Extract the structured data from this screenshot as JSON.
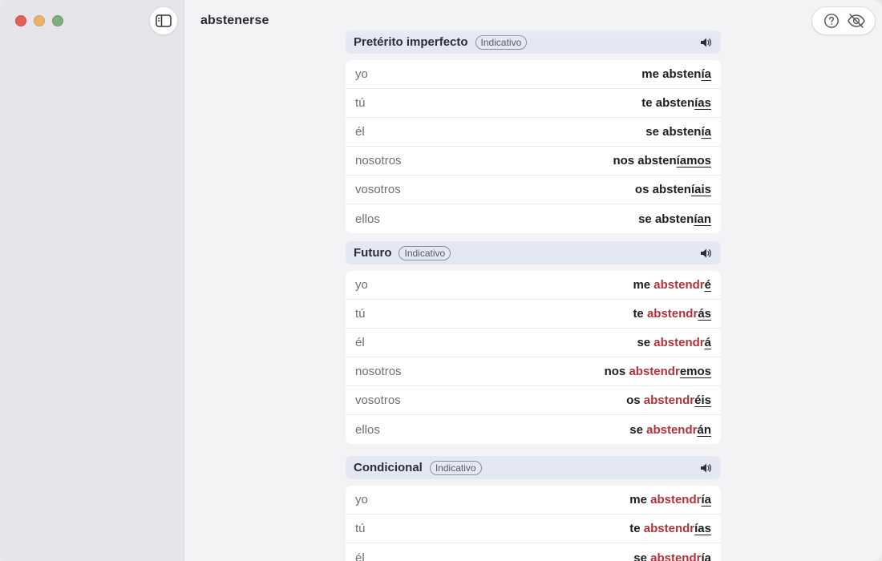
{
  "window": {
    "title": "abstenerse"
  },
  "colors": {
    "irregular_stem": "#b3323a",
    "section_header_bg": "#e4e8f3"
  },
  "sections": [
    {
      "title": "Pretérito imperfecto",
      "mood": "Indicativo",
      "rows": [
        {
          "pronoun": "yo",
          "reflexive": "me",
          "stem": "absten",
          "ending": "ía",
          "irregular": false
        },
        {
          "pronoun": "tú",
          "reflexive": "te",
          "stem": "absten",
          "ending": "ías",
          "irregular": false
        },
        {
          "pronoun": "él",
          "reflexive": "se",
          "stem": "absten",
          "ending": "ía",
          "irregular": false
        },
        {
          "pronoun": "nosotros",
          "reflexive": "nos",
          "stem": "absten",
          "ending": "íamos",
          "irregular": false
        },
        {
          "pronoun": "vosotros",
          "reflexive": "os",
          "stem": "absten",
          "ending": "íais",
          "irregular": false
        },
        {
          "pronoun": "ellos",
          "reflexive": "se",
          "stem": "absten",
          "ending": "ían",
          "irregular": false
        }
      ]
    },
    {
      "title": "Futuro",
      "mood": "Indicativo",
      "rows": [
        {
          "pronoun": "yo",
          "reflexive": "me",
          "stem": "abstendr",
          "ending": "é",
          "irregular": true
        },
        {
          "pronoun": "tú",
          "reflexive": "te",
          "stem": "abstendr",
          "ending": "ás",
          "irregular": true
        },
        {
          "pronoun": "él",
          "reflexive": "se",
          "stem": "abstendr",
          "ending": "á",
          "irregular": true
        },
        {
          "pronoun": "nosotros",
          "reflexive": "nos",
          "stem": "abstendr",
          "ending": "emos",
          "irregular": true
        },
        {
          "pronoun": "vosotros",
          "reflexive": "os",
          "stem": "abstendr",
          "ending": "éis",
          "irregular": true
        },
        {
          "pronoun": "ellos",
          "reflexive": "se",
          "stem": "abstendr",
          "ending": "án",
          "irregular": true
        }
      ]
    },
    {
      "title": "Condicional",
      "mood": "Indicativo",
      "rows": [
        {
          "pronoun": "yo",
          "reflexive": "me",
          "stem": "abstendr",
          "ending": "ía",
          "irregular": true
        },
        {
          "pronoun": "tú",
          "reflexive": "te",
          "stem": "abstendr",
          "ending": "ías",
          "irregular": true
        },
        {
          "pronoun": "él",
          "reflexive": "se",
          "stem": "abstendr",
          "ending": "ía",
          "irregular": true
        }
      ]
    }
  ]
}
